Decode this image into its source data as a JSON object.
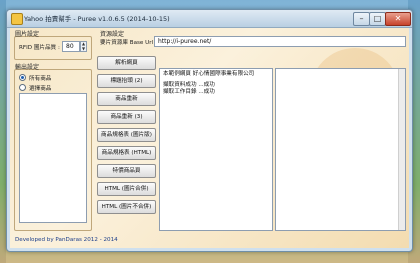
{
  "window": {
    "title": "Yahoo 拍賣幫手 - Puree v1.0.6.5 (2014-10-15)",
    "controls": {
      "minimize": "–",
      "maximize": "□",
      "close": "✕"
    }
  },
  "settings_group": {
    "label": "圖片設定",
    "rfid_label": "RFID 圖片品質 :",
    "rfid_value": "80"
  },
  "output_group": {
    "label": "輸出設定",
    "options": [
      "所有商品",
      "選擇商品"
    ],
    "selected_index": 0
  },
  "resource_group": {
    "label": "資源設定",
    "url_label": "要片資源庫 Base Url :",
    "url_value": "http://i-puree.net/"
  },
  "actions": [
    "解析網頁",
    "標題抬頭 (2)",
    "商品重新",
    "商品重新 (3)",
    "商品規格表 (圖片版)",
    "商品規格表 (HTML)",
    "特價商品頁",
    "HTML (圖片合併)",
    "HTML (圖片不合併)"
  ],
  "log": {
    "lines": [
      "本範例網頁 好心情國際事業有限公司",
      "",
      "擷取資料成功 ...成功",
      "擷取工作目錄 ...成功"
    ]
  },
  "footer": "Developed by PanDaras 2012 - 2014"
}
